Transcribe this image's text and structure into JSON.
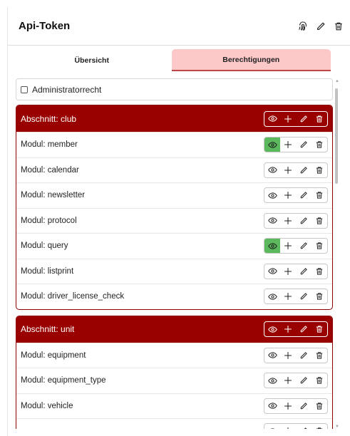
{
  "header": {
    "title": "Api-Token"
  },
  "header_icons": [
    "fingerprint-icon",
    "pencil-icon",
    "trash-icon"
  ],
  "tabs": [
    {
      "label": "Übersicht",
      "active": false
    },
    {
      "label": "Berechtigungen",
      "active": true
    }
  ],
  "admin": {
    "label": "Administratorrecht",
    "checked": false
  },
  "sections": [
    {
      "label": "Abschnitt: club",
      "modules": [
        {
          "label": "Modul: member",
          "view_active": true
        },
        {
          "label": "Modul: calendar",
          "view_active": false
        },
        {
          "label": "Modul: newsletter",
          "view_active": false
        },
        {
          "label": "Modul: protocol",
          "view_active": false
        },
        {
          "label": "Modul: query",
          "view_active": true
        },
        {
          "label": "Modul: listprint",
          "view_active": false
        },
        {
          "label": "Modul: driver_license_check",
          "view_active": false
        }
      ]
    },
    {
      "label": "Abschnitt: unit",
      "modules": [
        {
          "label": "Modul: equipment",
          "view_active": false
        },
        {
          "label": "Modul: equipment_type",
          "view_active": false
        },
        {
          "label": "Modul: vehicle",
          "view_active": false
        },
        {
          "label": "",
          "view_active": false
        }
      ]
    }
  ],
  "permission_icons": [
    "eye-icon",
    "plus-icon",
    "pencil-icon",
    "trash-icon"
  ],
  "colors": {
    "section_header": "#990000",
    "active_tab": "#fcc8c8",
    "view_active": "#5cb85c"
  }
}
